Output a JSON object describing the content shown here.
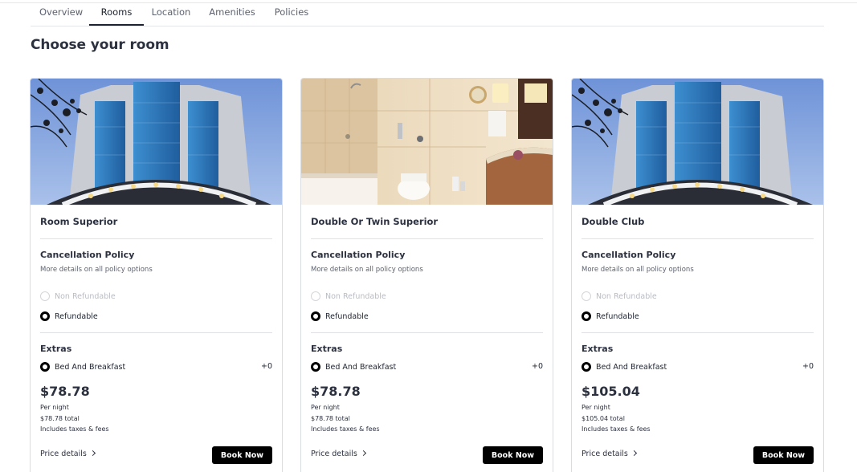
{
  "tabs": [
    {
      "label": "Overview"
    },
    {
      "label": "Rooms",
      "active": true
    },
    {
      "label": "Location"
    },
    {
      "label": "Amenities"
    },
    {
      "label": "Policies"
    }
  ],
  "heading": "Choose your room",
  "colors": {
    "accent": "#000000",
    "text": "#2c3140",
    "muted": "#5c6270",
    "disabled": "#b8bcc4",
    "border": "#d9dce1"
  },
  "rooms": [
    {
      "image": "hotel-exterior-photo",
      "name": "Room Superior",
      "cancellation_title": "Cancellation Policy",
      "cancellation_sub": "More details on all policy options",
      "option_non_refundable": "Non Refundable",
      "option_refundable": "Refundable",
      "selected_option": "Refundable",
      "extras_title": "Extras",
      "extra_label": "Bed And Breakfast",
      "extra_price": "+0",
      "price": "$78.78",
      "per_night": "Per night",
      "total": "$78.78 total",
      "taxes": "Includes taxes & fees",
      "price_details": "Price details",
      "book": "Book Now"
    },
    {
      "image": "bathroom-photo",
      "name": "Double Or Twin Superior",
      "cancellation_title": "Cancellation Policy",
      "cancellation_sub": "More details on all policy options",
      "option_non_refundable": "Non Refundable",
      "option_refundable": "Refundable",
      "selected_option": "Refundable",
      "extras_title": "Extras",
      "extra_label": "Bed And Breakfast",
      "extra_price": "+0",
      "price": "$78.78",
      "per_night": "Per night",
      "total": "$78.78 total",
      "taxes": "Includes taxes & fees",
      "price_details": "Price details",
      "book": "Book Now"
    },
    {
      "image": "hotel-exterior-photo",
      "name": "Double Club",
      "cancellation_title": "Cancellation Policy",
      "cancellation_sub": "More details on all policy options",
      "option_non_refundable": "Non Refundable",
      "option_refundable": "Refundable",
      "selected_option": "Refundable",
      "extras_title": "Extras",
      "extra_label": "Bed And Breakfast",
      "extra_price": "+0",
      "price": "$105.04",
      "per_night": "Per night",
      "total": "$105.04 total",
      "taxes": "Includes taxes & fees",
      "price_details": "Price details",
      "book": "Book Now"
    }
  ]
}
